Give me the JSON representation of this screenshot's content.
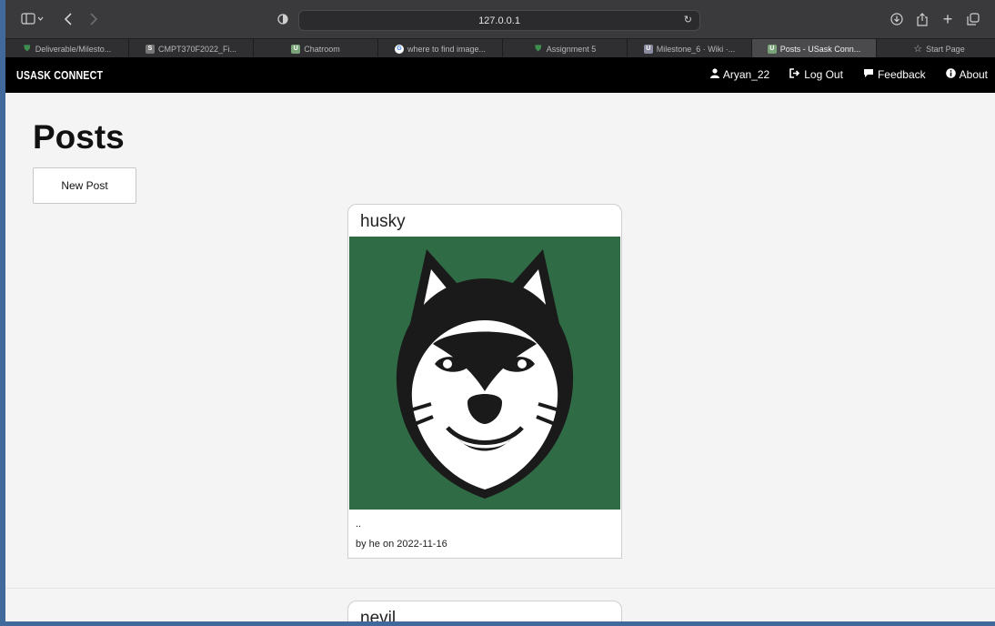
{
  "browser": {
    "url": "127.0.0.1",
    "tabs": [
      {
        "label": "Deliverable/Milesto...",
        "favicon": "shield",
        "color": "#3e8f4f"
      },
      {
        "label": "CMPT370F2022_Fi...",
        "favicon": "S",
        "color": "#777777"
      },
      {
        "label": "Chatroom",
        "favicon": "U",
        "color": "#7aa37a"
      },
      {
        "label": "where to find image...",
        "favicon": "G",
        "color": "#ffffff"
      },
      {
        "label": "Assignment 5",
        "favicon": "shield",
        "color": "#3e8f4f"
      },
      {
        "label": "Milestone_6 · Wiki ·...",
        "favicon": "U",
        "color": "#8a8aa0"
      },
      {
        "label": "Posts - USask Conn...",
        "favicon": "U",
        "color": "#7aa37a",
        "active": true
      },
      {
        "label": "Start Page",
        "favicon": "star",
        "color": "#bbbbbb"
      }
    ]
  },
  "nav": {
    "brand": "USASK CONNECT",
    "links": [
      {
        "label": "Aryan_22",
        "icon": "user-icon"
      },
      {
        "label": "Log Out",
        "icon": "logout-icon"
      },
      {
        "label": "Feedback",
        "icon": "comment-icon"
      },
      {
        "label": "About",
        "icon": "info-icon"
      }
    ]
  },
  "main": {
    "title": "Posts",
    "new_post_label": "New Post",
    "posts": [
      {
        "title": "husky",
        "description": "..",
        "meta": "by he on 2022-11-16",
        "image_bg": "#2f6b45"
      },
      {
        "title": "nevil"
      }
    ]
  }
}
